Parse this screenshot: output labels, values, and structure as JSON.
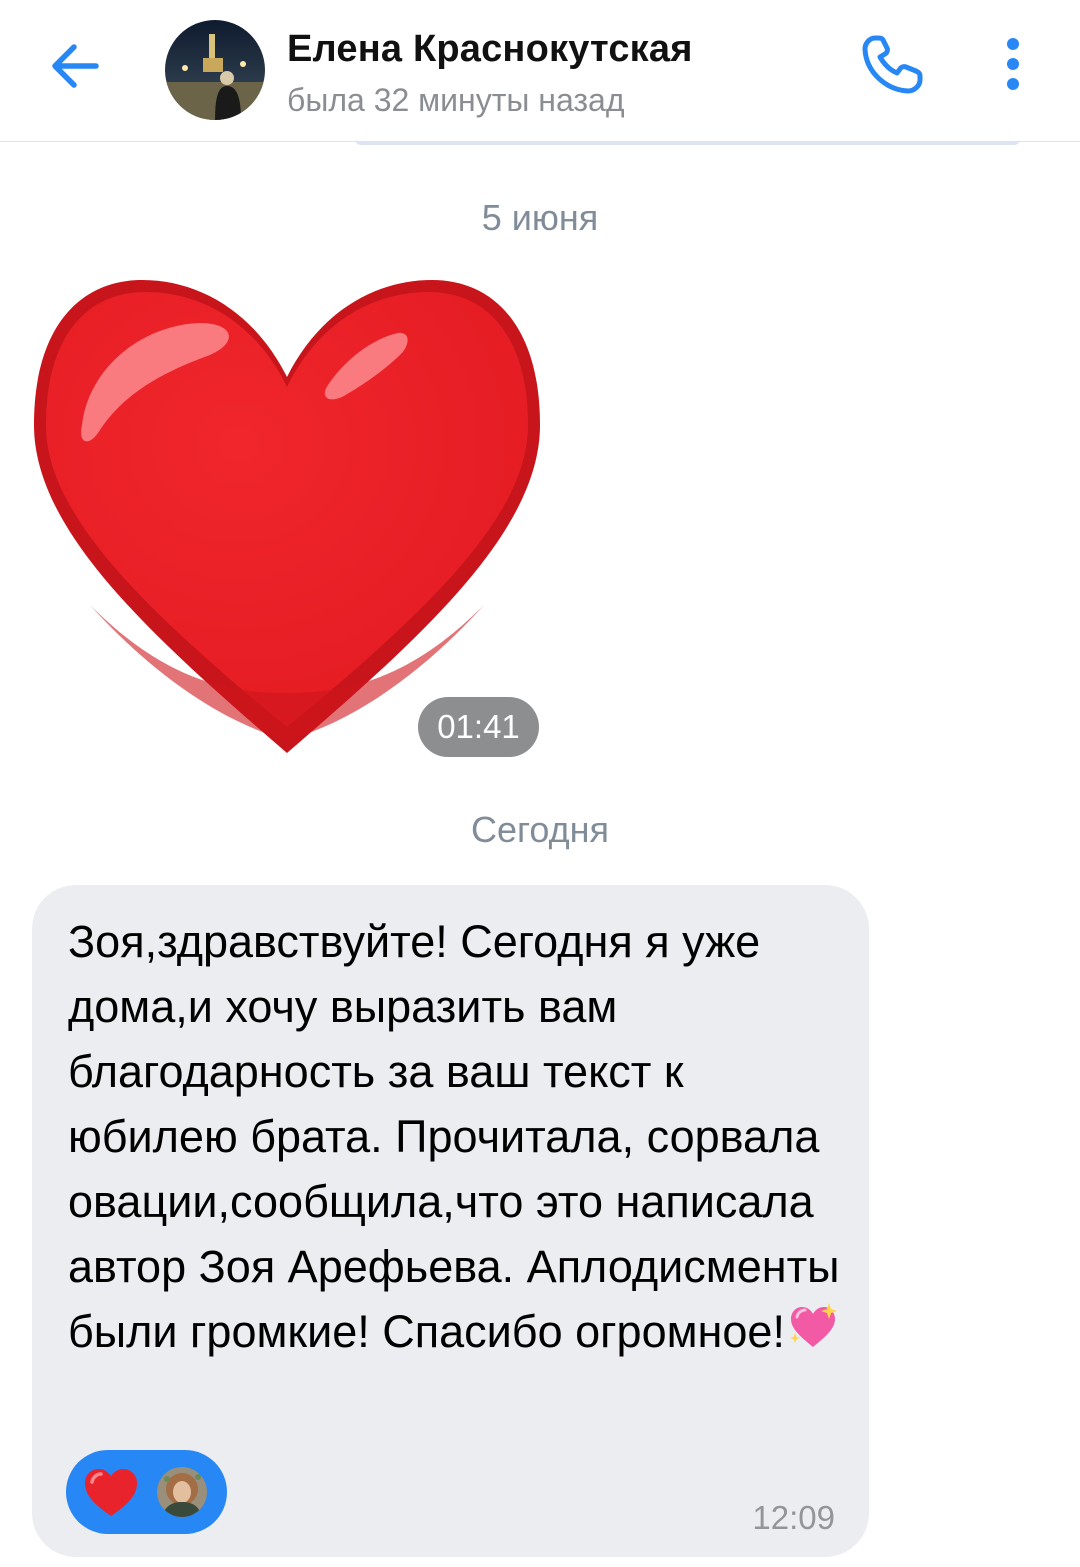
{
  "header": {
    "contact_name": "Елена Краснокутская",
    "contact_status": "была 32 минуты назад",
    "accent_color": "#2787f5"
  },
  "messages": {
    "date_1": "5 июня",
    "sticker": {
      "icon": "red-heart-sticker",
      "time": "01:41"
    },
    "date_2": "Сегодня",
    "text_message": {
      "text": "Зоя,здравствуйте! Сегодня я уже дома,и хочу выразить вам благодарность за ваш текст к юбилею брата. Прочитала, сорвала овации,сообщила,что это написала автор Зоя Арефьева. Аплодисменты были громкие! Спасибо огромное!",
      "trailing_emoji": "sparkling-heart",
      "time": "12:09",
      "reaction": {
        "icon": "red-heart",
        "color": "#2787f5"
      }
    }
  }
}
